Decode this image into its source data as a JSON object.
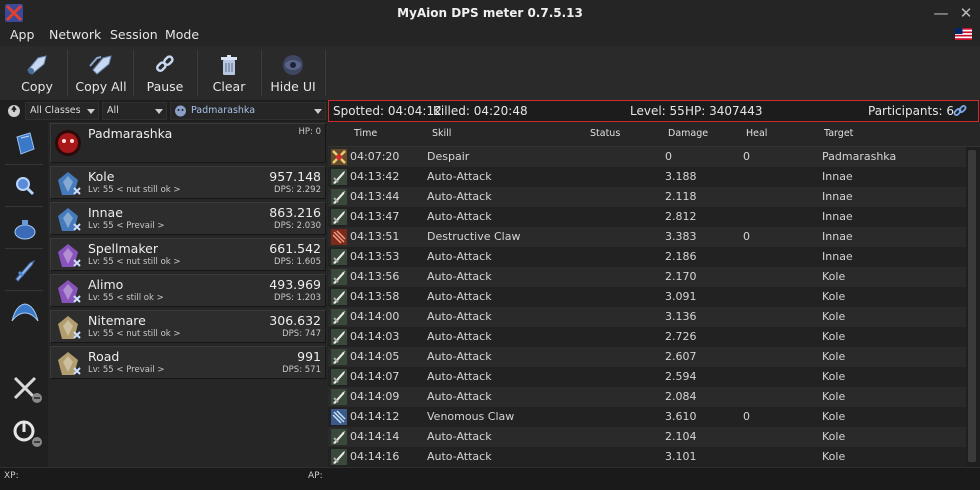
{
  "window": {
    "title": "MyAion DPS meter 0.7.5.13",
    "minimize": "—",
    "close": "✕"
  },
  "menu": [
    "App",
    "Network",
    "Session",
    "Mode"
  ],
  "toolbar": [
    "Copy",
    "Copy All",
    "Pause",
    "Clear",
    "Hide UI"
  ],
  "filters": {
    "class": "All Classes",
    "scope": "All",
    "target": "Padmarashka"
  },
  "info": {
    "spotted": "Spotted: 04:04:12",
    "killed": "Killed: 04:20:48",
    "level": "Level: 55",
    "hp": "HP: 3407443",
    "participants": "Participants: 6"
  },
  "sidebar_icons": [
    "spellbook-icon",
    "magnifier-icon",
    "potion-icon",
    "sword-icon",
    "wings-icon",
    "crossed-swords-icon",
    "power-icon"
  ],
  "target": {
    "name": "Padmarashka",
    "hp": "HP: 0"
  },
  "players": [
    {
      "name": "Kole",
      "sub": "Lv: 55  < nut still ok >",
      "damage": "957.148",
      "dps": "DPS: 2.292",
      "class": "gladiator",
      "color": "#4a8ad6"
    },
    {
      "name": "Innae",
      "sub": "Lv: 55  < Prevail >",
      "damage": "863.216",
      "dps": "DPS: 2.030",
      "class": "gladiator",
      "color": "#4a8ad6"
    },
    {
      "name": "Spellmaker",
      "sub": "Lv: 55  < nut still ok >",
      "damage": "661.542",
      "dps": "DPS: 1.605",
      "class": "sorcerer",
      "color": "#9a5ad6"
    },
    {
      "name": "Alimo",
      "sub": "Lv: 55  < still ok >",
      "damage": "493.969",
      "dps": "DPS: 1.203",
      "class": "sorcerer",
      "color": "#9a5ad6"
    },
    {
      "name": "Nitemare",
      "sub": "Lv: 55  < nut still ok >",
      "damage": "306.632",
      "dps": "DPS: 747",
      "class": "cleric",
      "color": "#c9b27a"
    },
    {
      "name": "Road",
      "sub": "Lv: 55  < Prevail >",
      "damage": "991",
      "dps": "DPS: 571",
      "class": "cleric",
      "color": "#c9b27a"
    }
  ],
  "log": {
    "headers": [
      "Time",
      "Skill",
      "Status",
      "Damage",
      "Heal",
      "Target"
    ],
    "rows": [
      {
        "icon": "despair",
        "time": "04:07:20",
        "skill": "Despair",
        "status": "",
        "damage": "0",
        "heal": "0",
        "target": "Padmarashka"
      },
      {
        "icon": "auto",
        "time": "04:13:42",
        "skill": "Auto-Attack",
        "status": "",
        "damage": "3.188",
        "heal": "",
        "target": "Innae"
      },
      {
        "icon": "auto",
        "time": "04:13:44",
        "skill": "Auto-Attack",
        "status": "",
        "damage": "2.118",
        "heal": "",
        "target": "Innae"
      },
      {
        "icon": "auto",
        "time": "04:13:47",
        "skill": "Auto-Attack",
        "status": "",
        "damage": "2.812",
        "heal": "",
        "target": "Innae"
      },
      {
        "icon": "claw",
        "time": "04:13:51",
        "skill": "Destructive Claw",
        "status": "",
        "damage": "3.383",
        "heal": "0",
        "target": "Innae"
      },
      {
        "icon": "auto",
        "time": "04:13:53",
        "skill": "Auto-Attack",
        "status": "",
        "damage": "2.186",
        "heal": "",
        "target": "Innae"
      },
      {
        "icon": "auto",
        "time": "04:13:56",
        "skill": "Auto-Attack",
        "status": "",
        "damage": "2.170",
        "heal": "",
        "target": "Kole"
      },
      {
        "icon": "auto",
        "time": "04:13:58",
        "skill": "Auto-Attack",
        "status": "",
        "damage": "3.091",
        "heal": "",
        "target": "Kole"
      },
      {
        "icon": "auto",
        "time": "04:14:00",
        "skill": "Auto-Attack",
        "status": "",
        "damage": "3.136",
        "heal": "",
        "target": "Kole"
      },
      {
        "icon": "auto",
        "time": "04:14:03",
        "skill": "Auto-Attack",
        "status": "",
        "damage": "2.726",
        "heal": "",
        "target": "Kole"
      },
      {
        "icon": "auto",
        "time": "04:14:05",
        "skill": "Auto-Attack",
        "status": "",
        "damage": "2.607",
        "heal": "",
        "target": "Kole"
      },
      {
        "icon": "auto",
        "time": "04:14:07",
        "skill": "Auto-Attack",
        "status": "",
        "damage": "2.594",
        "heal": "",
        "target": "Kole"
      },
      {
        "icon": "auto",
        "time": "04:14:09",
        "skill": "Auto-Attack",
        "status": "",
        "damage": "2.084",
        "heal": "",
        "target": "Kole"
      },
      {
        "icon": "venom",
        "time": "04:14:12",
        "skill": "Venomous Claw",
        "status": "",
        "damage": "3.610",
        "heal": "0",
        "target": "Kole"
      },
      {
        "icon": "auto",
        "time": "04:14:14",
        "skill": "Auto-Attack",
        "status": "",
        "damage": "2.104",
        "heal": "",
        "target": "Kole"
      },
      {
        "icon": "auto",
        "time": "04:14:16",
        "skill": "Auto-Attack",
        "status": "",
        "damage": "3.101",
        "heal": "",
        "target": "Kole"
      }
    ]
  },
  "status": {
    "xp": "XP:",
    "ap": "AP:"
  }
}
